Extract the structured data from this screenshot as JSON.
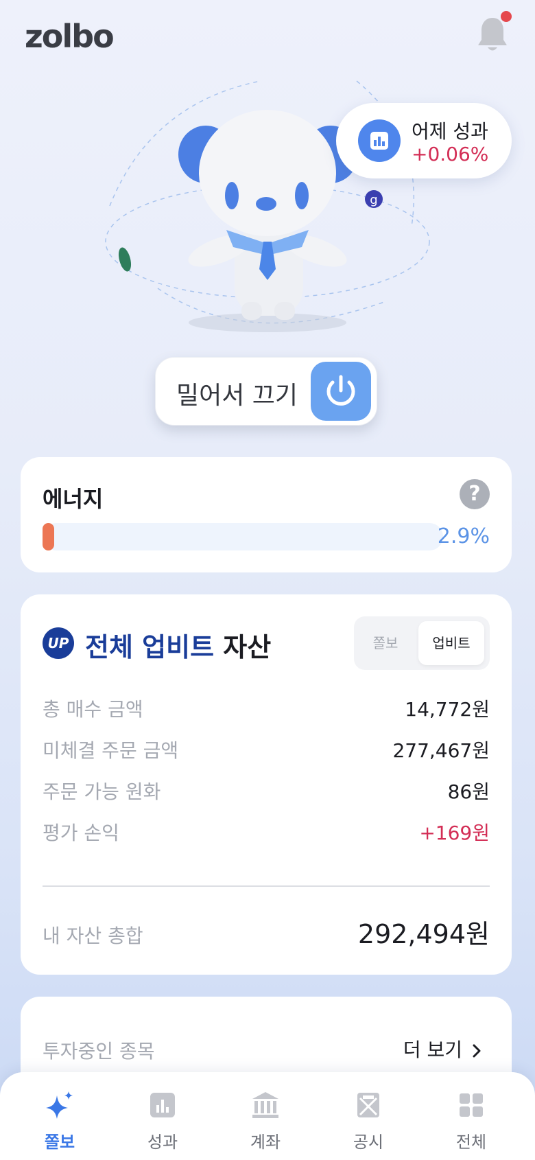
{
  "header": {
    "logo_text": "zolbo",
    "notification_badge": true
  },
  "colors": {
    "accent_blue": "#4f86ec",
    "profit_red": "#d32d55",
    "energy_orange": "#ec7654",
    "brand_navy": "#1a3d99"
  },
  "hero": {
    "mascot": "blue-eared-bear-mascot",
    "yesterday_label": "어제 성과",
    "yesterday_value": "+0.06%"
  },
  "swipe": {
    "label": "밀어서 끄기"
  },
  "energy": {
    "title": "에너지",
    "percent_label": "2.9%",
    "percent_value": 0.029,
    "help_glyph": "?"
  },
  "assets": {
    "logo_text": "UP",
    "title_brand": "전체 업비트",
    "title_rest": "자산",
    "segments": [
      "쫄보",
      "업비트"
    ],
    "selected_segment": "업비트",
    "rows": [
      {
        "label": "총 매수 금액",
        "value": "14,772원"
      },
      {
        "label": "미체결 주문 금액",
        "value": "277,467원"
      },
      {
        "label": "주문 가능 원화",
        "value": "86원"
      },
      {
        "label": "평가 손익",
        "value": "+169원"
      }
    ],
    "total_label": "내 자산 총합",
    "total_value": "292,494원"
  },
  "invest": {
    "label": "투자중인 종목",
    "more_label": "더 보기"
  },
  "tabbar": {
    "tabs": [
      {
        "label": "쫄보",
        "icon": "sparkle-icon",
        "active": true
      },
      {
        "label": "성과",
        "icon": "bar-chart-icon",
        "active": false
      },
      {
        "label": "계좌",
        "icon": "bank-icon",
        "active": false
      },
      {
        "label": "공시",
        "icon": "document-icon",
        "active": false
      },
      {
        "label": "전체",
        "icon": "grid-icon",
        "active": false
      }
    ]
  }
}
